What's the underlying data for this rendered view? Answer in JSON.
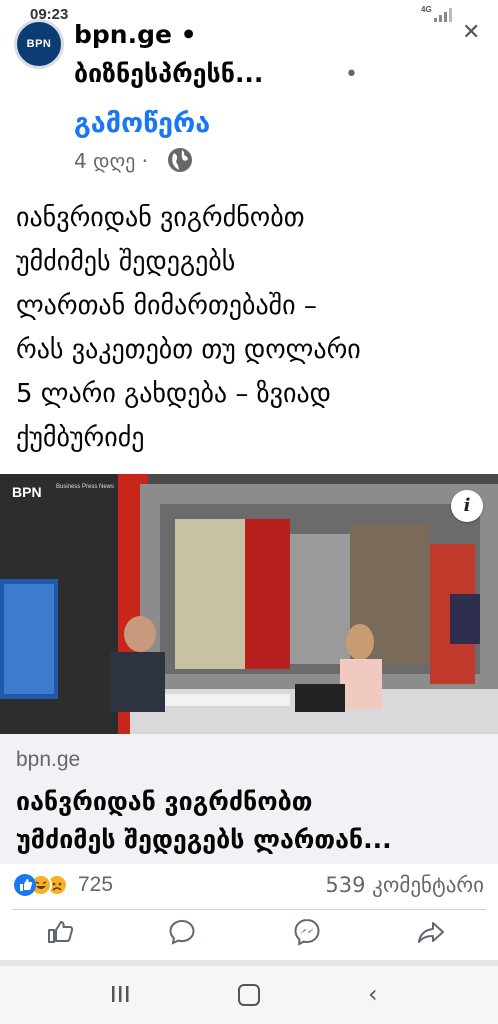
{
  "status": {
    "time": "09:23",
    "network": "4G"
  },
  "header": {
    "page_name": "bpn.ge •",
    "page_name_line2": "ბიზნესპრესნ...",
    "follow_label": "გამოწერა",
    "post_age": "4 დღე ·",
    "avatar_text": "BPN",
    "close_icon": "close-icon"
  },
  "post": {
    "text": "იანვრიდან ვიგრძნობთ\nუმძიმეს შედეგებს\nლართან მიმართებაში –\nრას ვაკეთებთ თუ დოლარი\n5 ლარი გახდება – ზვიად\nქუმბურიძე"
  },
  "image": {
    "logo_text": "BPN",
    "logo_small": "Business Press News",
    "info_label": "i"
  },
  "link_preview": {
    "domain": "bpn.ge",
    "title": "იანვრიდან ვიგრძნობთ\nუმძიმეს შედეგებს ლართან..."
  },
  "engagement": {
    "reaction_count": "725",
    "comment_count": "539 კომენტარი"
  },
  "actions": [
    "like-icon",
    "comment-icon",
    "messenger-icon",
    "share-icon"
  ],
  "colors": {
    "accent": "#1877f2",
    "muted": "#65676b"
  }
}
